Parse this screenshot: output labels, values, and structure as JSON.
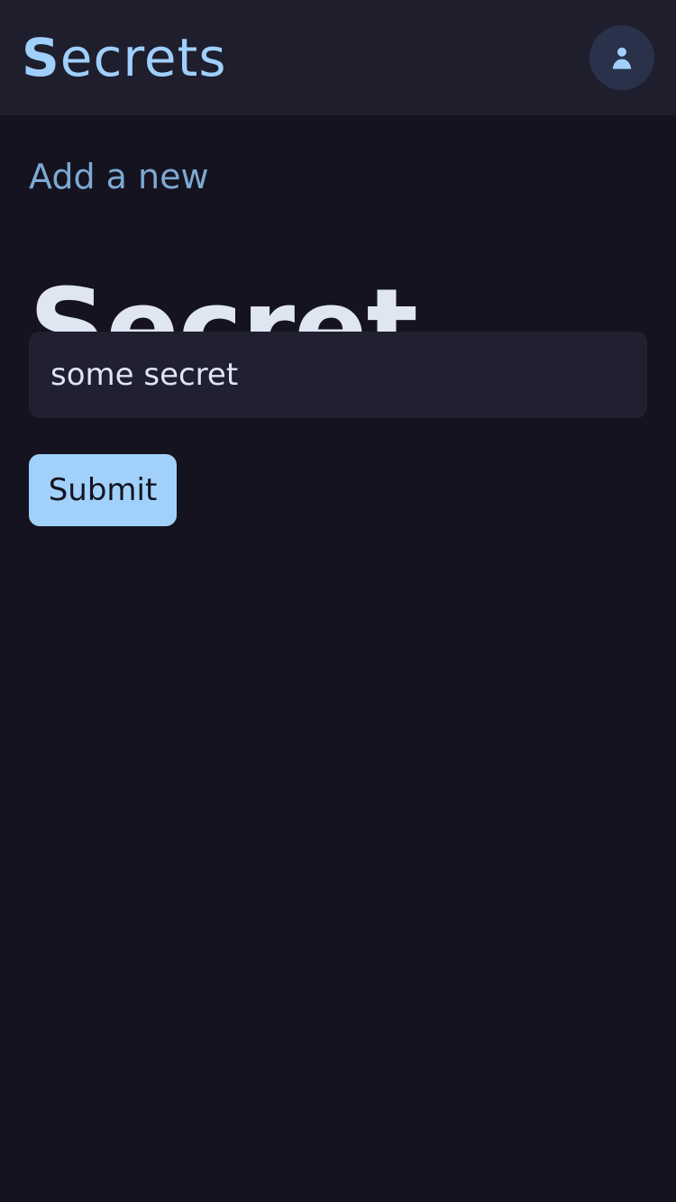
{
  "app": {
    "logo_initial": "S",
    "logo_rest": "ecrets"
  },
  "header": {
    "avatar_icon": "user-icon"
  },
  "form": {
    "eyebrow": "Add a new",
    "title": "Secret",
    "input": {
      "value": "some secret",
      "placeholder": ""
    },
    "submit_label": "Submit"
  },
  "colors": {
    "background": "#14131f",
    "header_background": "#1f1e2d",
    "accent": "#a1d1fb",
    "muted_accent": "#7ea9d3",
    "input_background": "#202030",
    "avatar_background": "#29324a",
    "text": "#dfe5f1"
  }
}
